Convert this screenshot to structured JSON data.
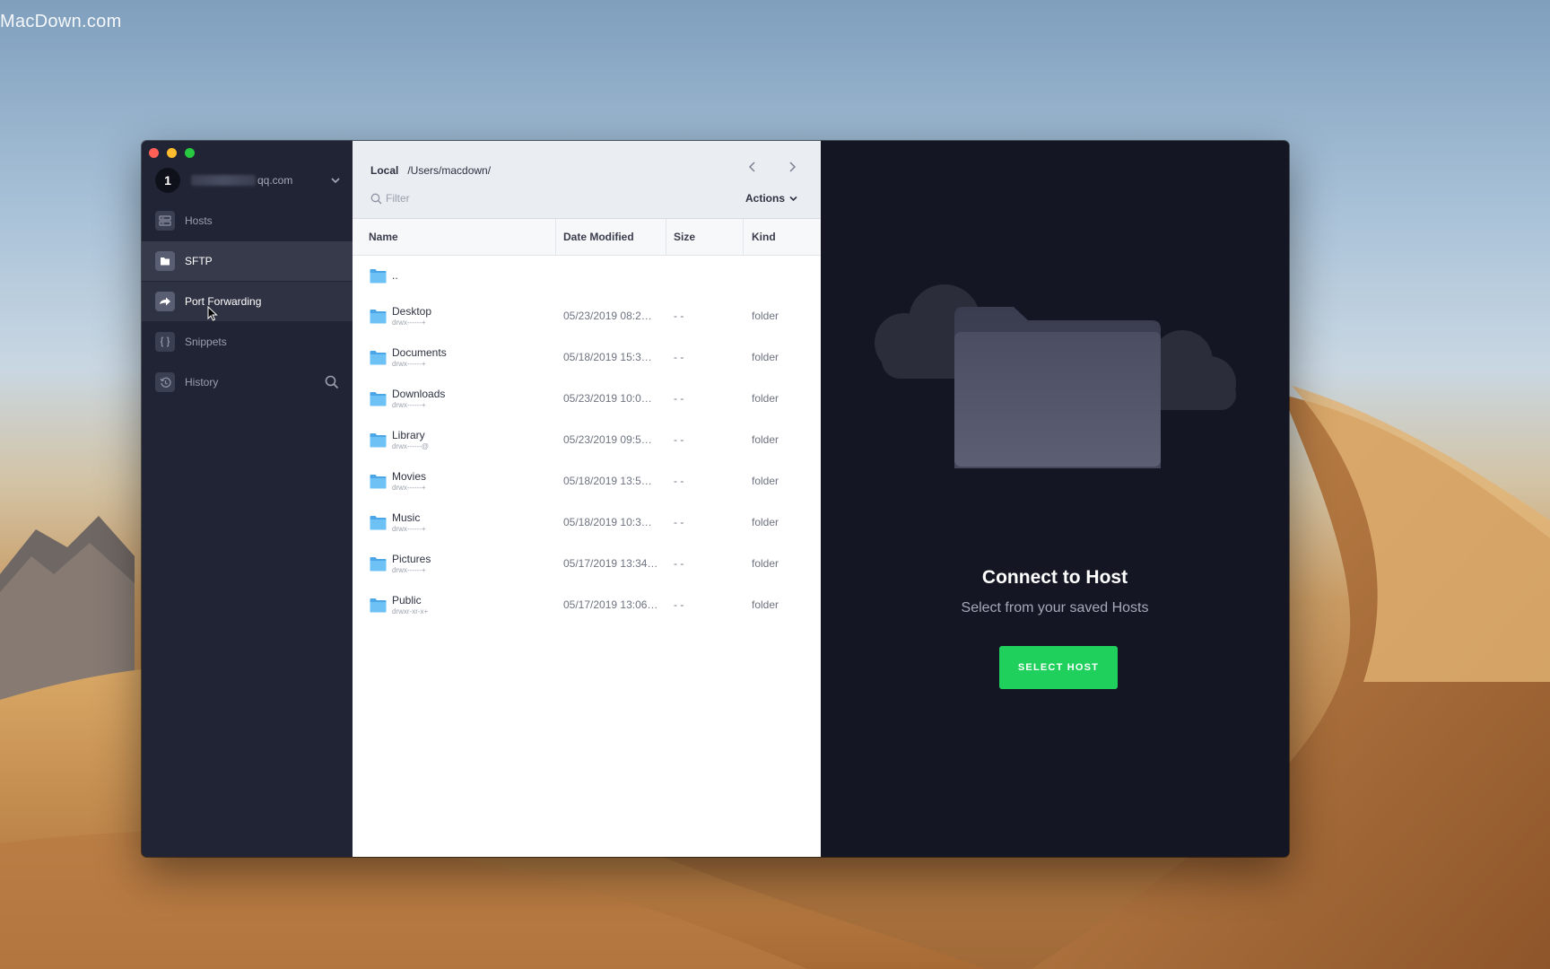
{
  "watermark": "MacDown.com",
  "account": {
    "badge": "1",
    "email_suffix": "qq.com"
  },
  "sidebar": {
    "items": [
      {
        "label": "Hosts",
        "icon": "hosts-icon"
      },
      {
        "label": "SFTP",
        "icon": "sftp-icon"
      },
      {
        "label": "Port Forwarding",
        "icon": "port-forwarding-icon"
      },
      {
        "label": "Snippets",
        "icon": "snippets-icon"
      },
      {
        "label": "History",
        "icon": "history-icon"
      }
    ]
  },
  "filepane": {
    "location_label": "Local",
    "path": "/Users/macdown/",
    "filter_placeholder": "Filter",
    "actions_label": "Actions",
    "columns": {
      "name": "Name",
      "date": "Date Modified",
      "size": "Size",
      "kind": "Kind"
    },
    "parent_entry": "..",
    "rows": [
      {
        "name": "Desktop",
        "perm": "drwx------+",
        "date": "05/23/2019 08:2…",
        "size": "- -",
        "kind": "folder"
      },
      {
        "name": "Documents",
        "perm": "drwx------+",
        "date": "05/18/2019 15:3…",
        "size": "- -",
        "kind": "folder"
      },
      {
        "name": "Downloads",
        "perm": "drwx------+",
        "date": "05/23/2019 10:0…",
        "size": "- -",
        "kind": "folder"
      },
      {
        "name": "Library",
        "perm": "drwx------@",
        "date": "05/23/2019 09:5…",
        "size": "- -",
        "kind": "folder"
      },
      {
        "name": "Movies",
        "perm": "drwx------+",
        "date": "05/18/2019 13:5…",
        "size": "- -",
        "kind": "folder"
      },
      {
        "name": "Music",
        "perm": "drwx------+",
        "date": "05/18/2019 10:3…",
        "size": "- -",
        "kind": "folder"
      },
      {
        "name": "Pictures",
        "perm": "drwx------+",
        "date": "05/17/2019 13:34…",
        "size": "- -",
        "kind": "folder"
      },
      {
        "name": "Public",
        "perm": "drwxr-xr-x+",
        "date": "05/17/2019 13:06…",
        "size": "- -",
        "kind": "folder"
      }
    ]
  },
  "connect": {
    "title": "Connect to Host",
    "subtitle": "Select from your saved Hosts",
    "button": "SELECT HOST"
  },
  "colors": {
    "accent_green": "#1fd15c",
    "sidebar_bg": "#212434",
    "right_bg": "#141623",
    "folder_blue": "#5fb6f0"
  }
}
